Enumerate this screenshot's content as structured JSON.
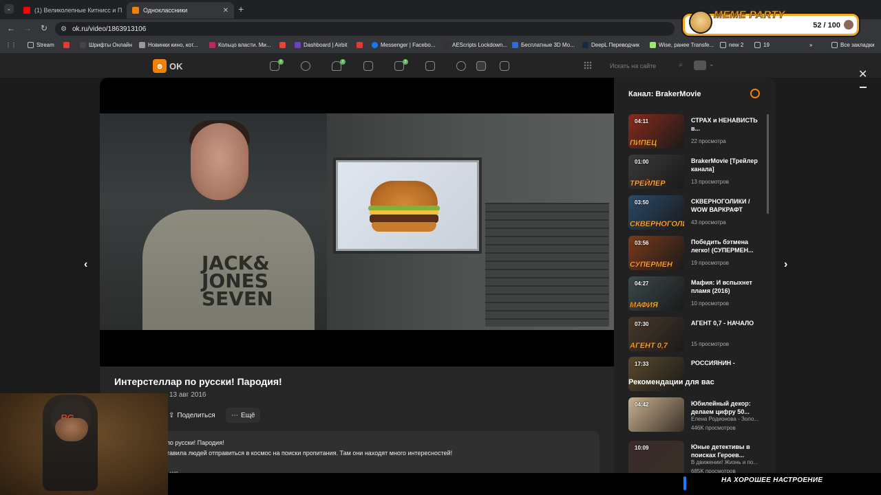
{
  "browser": {
    "tabs": [
      {
        "label": "(1) Великолепные Китнисс и П",
        "active": false
      },
      {
        "label": "Одноклассники",
        "active": true
      }
    ],
    "url": "ok.ru/video/1863913106",
    "bookmarks": [
      {
        "label": "Stream",
        "icon": "folder-icon"
      },
      {
        "label": "",
        "icon": "youtube-icon"
      },
      {
        "label": "Шрифты Онлайн",
        "icon": "font-icon"
      },
      {
        "label": "Новинки кино, кот...",
        "icon": "film-icon"
      },
      {
        "label": "Кольцо власти. Ми...",
        "icon": "ring-icon"
      },
      {
        "label": "",
        "icon": "gmail-icon"
      },
      {
        "label": "Dashboard | Airbit",
        "icon": "airbit-icon"
      },
      {
        "label": "",
        "icon": "youtube-icon"
      },
      {
        "label": "Messenger | Facebo...",
        "icon": "facebook-icon"
      },
      {
        "label": "AEScripts Lockdown...",
        "icon": "aescripts-icon"
      },
      {
        "label": "Бесплатные 3D Мо...",
        "icon": "3d-icon"
      },
      {
        "label": "DeepL Переводчик",
        "icon": "deepl-icon"
      },
      {
        "label": "Wise, ранее Transfe...",
        "icon": "wise-icon"
      },
      {
        "label": "new 2",
        "icon": "folder-icon"
      },
      {
        "label": "19",
        "icon": "folder-icon"
      }
    ],
    "all_bookmarks": "Все закладки"
  },
  "overlay": {
    "meme_title": "MEME PARTY",
    "meme_count": "52 / 100",
    "banner_text": "НА ХОРОШЕЕ НАСТРОЕНИЕ"
  },
  "ok": {
    "logo": "OK",
    "search_placeholder": "Искать на сайте",
    "badges": [
      "2",
      "2",
      "2"
    ]
  },
  "video": {
    "title": "Интерстеллар по русски! Пародия!",
    "date": "13 авг 2016",
    "share_label": "Поделиться",
    "more_label": "Ещё",
    "desc_title": "по русски! Пародия!",
    "desc_text": "тавила людей отправиться в космос на поиски пропитания. Там они находят много интересностей!",
    "desc_more": "ьше",
    "shirt_text": "JACK& JONES SEVEN"
  },
  "sidebar": {
    "channel_title": "Канал: BrakerMovie",
    "channel_videos": [
      {
        "duration": "04:11",
        "title": "СТРАХ и НЕНАВИСТЬ в...",
        "views": "22 просмотра",
        "caption": "ПИПЕЦ",
        "color": "#8a2a1c"
      },
      {
        "duration": "01:00",
        "title": "BrakerMovie [Трейлер канала]",
        "views": "13 просмотров",
        "caption": "ТРЕЙЛЕР",
        "color": "#3a3a3a"
      },
      {
        "duration": "03:50",
        "title": "СКВЕРНОГОЛИКИ / WOW ВАРКРАФТ",
        "views": "43 просмотра",
        "caption": "СКВЕРНОГОЛИКИ",
        "color": "#2a4a6a"
      },
      {
        "duration": "03:56",
        "title": "Победить бэтмена легко! (СУПЕРМЕН...",
        "views": "19 просмотров",
        "caption": "СУПЕРМЕН",
        "color": "#7a3a1a"
      },
      {
        "duration": "04:27",
        "title": "Мафия: И вспыхнет пламя (2016)",
        "views": "10 просмотров",
        "caption": "МАФИЯ",
        "color": "#3a4a4a"
      },
      {
        "duration": "07:30",
        "title": "АГЕНТ 0,7 - НАЧАЛО",
        "views": "15 просмотров",
        "caption": "АГЕНТ 0,7",
        "color": "#4a3a2a"
      },
      {
        "duration": "17:33",
        "title": "РОССИЯНИН -",
        "views": "",
        "caption": "",
        "color": "#5a4a2a"
      }
    ],
    "rec_title": "Рекомендации для вас",
    "recommendations": [
      {
        "duration": "04:42",
        "title": "Юбилейный декор: делаем цифру 50...",
        "author": "Елена Родионова - Золо...",
        "views": "446K просмотров",
        "color": "#c9b291"
      },
      {
        "duration": "10:09",
        "title": "Юные детективы в поисках Героев...",
        "author": "В движении! Жизнь и по...",
        "views": "685K просмотров",
        "color": "#3a2a2a"
      }
    ]
  }
}
